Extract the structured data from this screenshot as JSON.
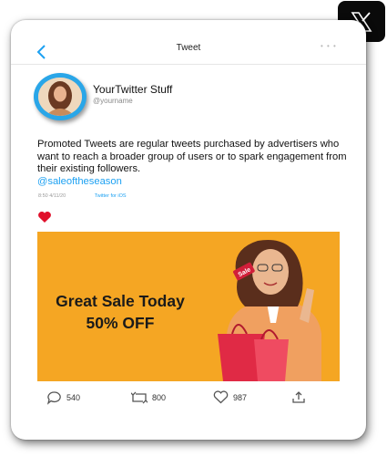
{
  "app": {
    "badge_icon": "x-logo-icon"
  },
  "nav": {
    "title": "Tweet",
    "back_icon": "chevron-left-icon",
    "menu_dots": "• • •"
  },
  "profile": {
    "display_name": "YourTwitter Stuff",
    "handle": "@yourname",
    "avatar_icon": "avatar-photo"
  },
  "tweet": {
    "text": "Promoted Tweets are regular tweets purchased by advertisers who want to reach a broader group of users or to spark engagement from their existing followers.",
    "hashtag": "@saleoftheseason",
    "timestamp": "8:50 4/11/20",
    "source": "Twitter for iOS",
    "liked": true
  },
  "promo": {
    "headline": "Great Sale Today",
    "subheadline": "50% OFF",
    "tag_text": "Sale",
    "background_color": "#f5a623"
  },
  "actions": {
    "reply_count": "540",
    "retweet_count": "800",
    "like_count": "987",
    "share_icon": "share-icon"
  },
  "colors": {
    "accent": "#1da1f2",
    "heart": "#e0102b"
  }
}
